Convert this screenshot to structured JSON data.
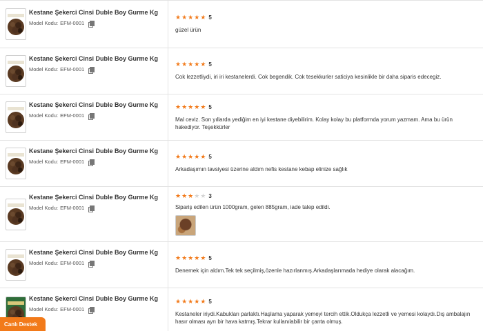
{
  "reviews": [
    {
      "product_title": "Kestane Şekerci Cinsi Duble Boy Gurme Kg",
      "model_label": "Model Kodu:",
      "model_code": "EFM-0001",
      "rating": 5,
      "rating_text": "5",
      "comment": "güzel ürün",
      "has_photo": false
    },
    {
      "product_title": "Kestane Şekerci Cinsi Duble Boy Gurme Kg",
      "model_label": "Model Kodu:",
      "model_code": "EFM-0001",
      "rating": 5,
      "rating_text": "5",
      "comment": "Cok lezzetliydi, iri iri kestanelerdi. Cok begendik. Cok tesekkurler saticiya kesinlikle bir daha siparis edecegiz.",
      "has_photo": false
    },
    {
      "product_title": "Kestane Şekerci Cinsi Duble Boy Gurme Kg",
      "model_label": "Model Kodu:",
      "model_code": "EFM-0001",
      "rating": 5,
      "rating_text": "5",
      "comment": "Mal ceviz. Son yıllarda yediğim en iyi kestane diyebilirim. Kolay kolay bu platformda yorum yazmam. Ama bu ürün hakediyor. Teşekkürler",
      "has_photo": false
    },
    {
      "product_title": "Kestane Şekerci Cinsi Duble Boy Gurme Kg",
      "model_label": "Model Kodu:",
      "model_code": "EFM-0001",
      "rating": 5,
      "rating_text": "5",
      "comment": "Arkadaşımın tavsiyesi üzerine aldım nefis kestane kebap elinize sağlık",
      "has_photo": false
    },
    {
      "product_title": "Kestane Şekerci Cinsi Duble Boy Gurme Kg",
      "model_label": "Model Kodu:",
      "model_code": "EFM-0001",
      "rating": 3,
      "rating_text": "3",
      "comment": "Sipariş edilen ürün 1000gram, gelen 885gram, iade talep edildi.",
      "has_photo": true
    },
    {
      "product_title": "Kestane Şekerci Cinsi Duble Boy Gurme Kg",
      "model_label": "Model Kodu:",
      "model_code": "EFM-0001",
      "rating": 5,
      "rating_text": "5",
      "comment": "Denemek için aldım.Tek tek seçilmiş,özenle hazırlanmış.Arkadaşlarımada hediye olarak alacağım.",
      "has_photo": false
    },
    {
      "product_title": "Kestane Şekerci Cinsi Duble Boy Gurme Kg",
      "model_label": "Model Kodu:",
      "model_code": "EFM-0001",
      "rating": 5,
      "rating_text": "5",
      "comment": "Kestaneler iriydi.Kabukları parlaktı.Haşlama yaparak yemeyi tercih ettik.Oldukça lezzetli ve yemesi kolaydı.Dış ambalajın hasır olması ayrı bir hava katmış.Tekrar kullanılabilir bir çanta olmuş.",
      "has_photo": false
    }
  ],
  "star_glyph": "★",
  "live_support_label": "Canlı Destek",
  "colors": {
    "accent": "#f27a1a",
    "star_off": "#d5d5d5",
    "border": "#e3e3e3"
  }
}
